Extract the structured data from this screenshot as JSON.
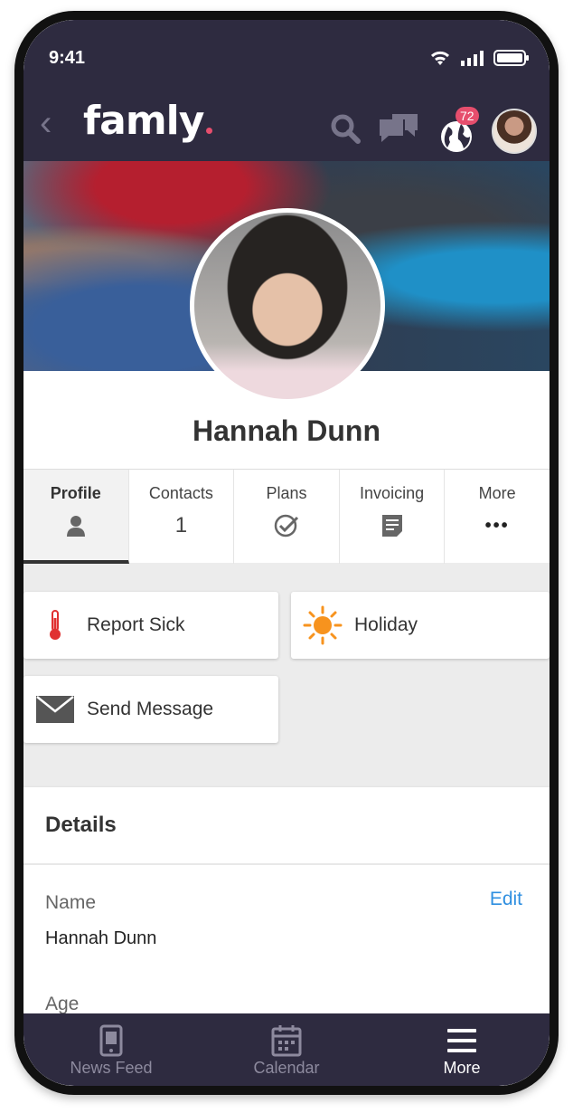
{
  "status_bar": {
    "time": "9:41"
  },
  "app_bar": {
    "logo": "famly",
    "notification_count": "72",
    "colors": {
      "bar": "#2e2b40",
      "badge": "#e64e6d"
    }
  },
  "profile": {
    "name": "Hannah Dunn",
    "tabs": [
      {
        "label": "Profile",
        "icon": "person-icon"
      },
      {
        "label": "Contacts",
        "count": "1"
      },
      {
        "label": "Plans",
        "icon": "check-circle-icon"
      },
      {
        "label": "Invoicing",
        "icon": "document-icon"
      },
      {
        "label": "More",
        "icon": "ellipsis-icon",
        "text": "•••"
      }
    ]
  },
  "actions": {
    "report_sick": "Report Sick",
    "holiday": "Holiday",
    "send_message": "Send Message"
  },
  "details": {
    "title": "Details",
    "name_label": "Name",
    "name_value": "Hannah Dunn",
    "edit_label": "Edit",
    "age_label": "Age"
  },
  "bottom_nav": [
    {
      "label": "News Feed",
      "icon": "phone-icon"
    },
    {
      "label": "Calendar",
      "icon": "calendar-icon"
    },
    {
      "label": "More",
      "icon": "hamburger-icon"
    }
  ]
}
